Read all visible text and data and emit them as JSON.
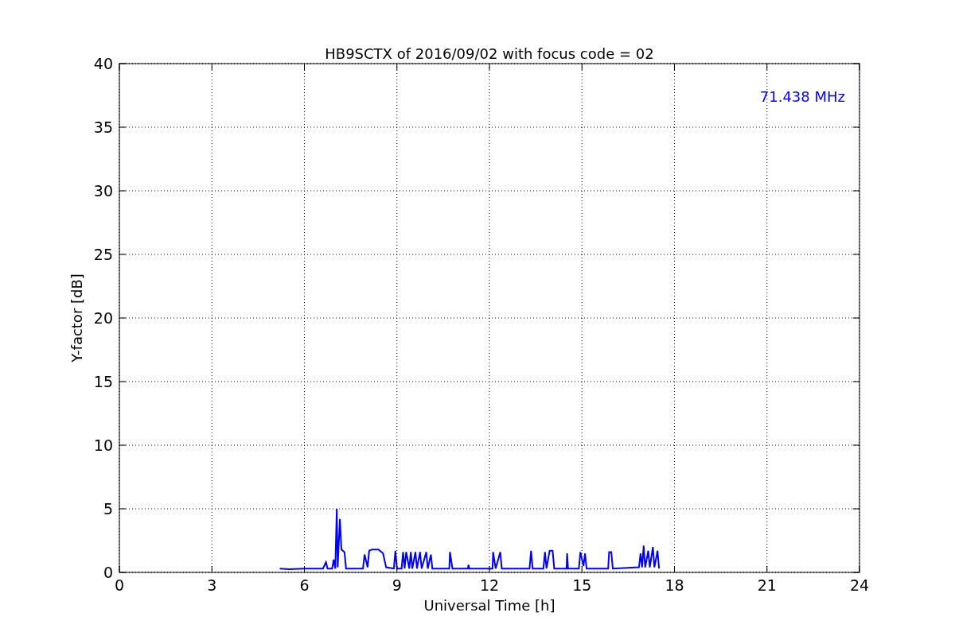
{
  "chart_data": {
    "type": "line",
    "title": "HB9SCTX of 2016/09/02 with focus code = 02",
    "xlabel": "Universal Time [h]",
    "ylabel": "Y-factor [dB]",
    "xlim": [
      0,
      24
    ],
    "ylim": [
      0,
      40
    ],
    "xticks": [
      0,
      3,
      6,
      9,
      12,
      15,
      18,
      21,
      24
    ],
    "yticks": [
      0,
      5,
      10,
      15,
      20,
      25,
      30,
      35,
      40
    ],
    "x": [
      5.2,
      5.5,
      6.0,
      6.6,
      6.7,
      6.75,
      6.9,
      6.95,
      7.0,
      7.05,
      7.08,
      7.15,
      7.2,
      7.3,
      7.35,
      7.9,
      7.95,
      8.05,
      8.1,
      8.2,
      8.4,
      8.55,
      8.65,
      8.9,
      8.95,
      9.0,
      9.15,
      9.2,
      9.25,
      9.3,
      9.4,
      9.45,
      9.5,
      9.6,
      9.65,
      9.75,
      9.8,
      9.95,
      10.0,
      10.1,
      10.15,
      10.7,
      10.72,
      10.8,
      11.3,
      11.32,
      11.35,
      12.1,
      12.12,
      12.2,
      12.35,
      12.4,
      13.3,
      13.35,
      13.4,
      13.75,
      13.8,
      13.85,
      13.95,
      14.05,
      14.1,
      14.5,
      14.52,
      14.55,
      14.9,
      14.95,
      15.05,
      15.1,
      15.15,
      15.85,
      15.88,
      15.95,
      16.0,
      16.85,
      16.9,
      16.95,
      17.0,
      17.05,
      17.15,
      17.2,
      17.3,
      17.35,
      17.45,
      17.5
    ],
    "series": [
      {
        "name": "71.438 MHz",
        "color": "#0000ff",
        "values": [
          0.3,
          0.25,
          0.3,
          0.3,
          0.8,
          0.3,
          0.3,
          1.0,
          0.3,
          5.0,
          0.4,
          4.2,
          1.8,
          1.6,
          0.3,
          0.3,
          1.4,
          0.4,
          1.7,
          1.8,
          1.8,
          1.5,
          0.4,
          0.3,
          1.7,
          0.3,
          0.3,
          1.6,
          0.3,
          1.6,
          0.3,
          1.6,
          0.3,
          1.6,
          0.3,
          1.6,
          0.3,
          1.6,
          0.3,
          1.4,
          0.3,
          0.3,
          1.6,
          0.3,
          0.3,
          0.6,
          0.3,
          0.3,
          1.6,
          0.3,
          1.6,
          0.3,
          0.3,
          1.7,
          0.3,
          0.3,
          1.6,
          0.3,
          1.7,
          1.7,
          0.3,
          0.3,
          1.5,
          0.3,
          0.3,
          1.6,
          0.5,
          1.5,
          0.3,
          0.3,
          1.6,
          1.6,
          0.3,
          0.4,
          1.5,
          0.4,
          2.1,
          0.4,
          1.7,
          0.4,
          2.0,
          0.4,
          1.7,
          0.3
        ]
      }
    ],
    "grid": true
  }
}
